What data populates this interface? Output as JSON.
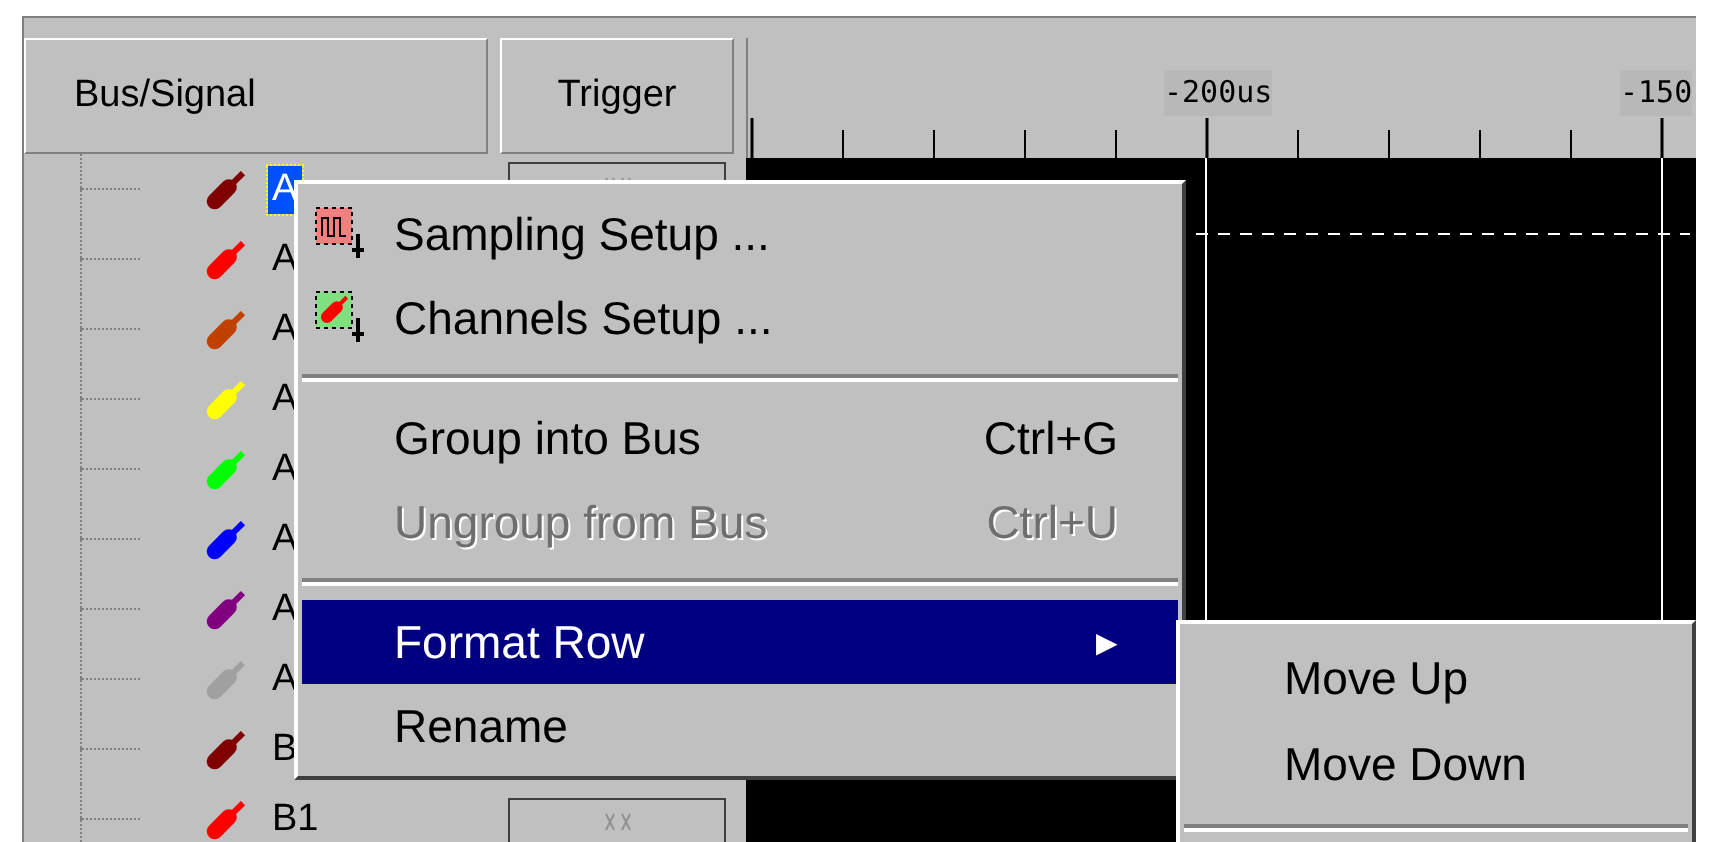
{
  "columns": [
    {
      "label": "Bus/Signal"
    },
    {
      "label": "Trigger"
    }
  ],
  "ruler": {
    "labels": [
      "-200us",
      "-150"
    ]
  },
  "signals": [
    {
      "label": "A",
      "color": "#800000",
      "selected": true
    },
    {
      "label": "A",
      "color": "#ff0000",
      "selected": false
    },
    {
      "label": "A",
      "color": "#c04000",
      "selected": false
    },
    {
      "label": "A",
      "color": "#ffff00",
      "selected": false
    },
    {
      "label": "A",
      "color": "#00ff00",
      "selected": false
    },
    {
      "label": "A",
      "color": "#0000ff",
      "selected": false
    },
    {
      "label": "A",
      "color": "#800080",
      "selected": false
    },
    {
      "label": "A",
      "color": "#a0a0a0",
      "selected": false
    },
    {
      "label": "B",
      "color": "#800000",
      "selected": false
    },
    {
      "label": "B1",
      "color": "#ff0000",
      "selected": false
    }
  ],
  "context_menu": {
    "items": [
      {
        "kind": "command",
        "label": "Sampling Setup ...",
        "disabled": false,
        "selected": false
      },
      {
        "kind": "command",
        "label": "Channels Setup ...",
        "disabled": false,
        "selected": false
      },
      {
        "kind": "separator"
      },
      {
        "kind": "command",
        "label": "Group into Bus",
        "shortcut": "Ctrl+G",
        "disabled": false,
        "selected": false
      },
      {
        "kind": "command",
        "label": "Ungroup from Bus",
        "shortcut": "Ctrl+U",
        "disabled": true,
        "selected": false
      },
      {
        "kind": "separator"
      },
      {
        "kind": "submenu",
        "label": "Format Row",
        "arrow": "▶",
        "disabled": false,
        "selected": true
      },
      {
        "kind": "command",
        "label": "Rename",
        "disabled": false,
        "selected": false
      }
    ]
  },
  "submenu": {
    "items": [
      {
        "kind": "command",
        "label": "Move Up"
      },
      {
        "kind": "command",
        "label": "Move Down"
      },
      {
        "kind": "separator"
      }
    ]
  }
}
